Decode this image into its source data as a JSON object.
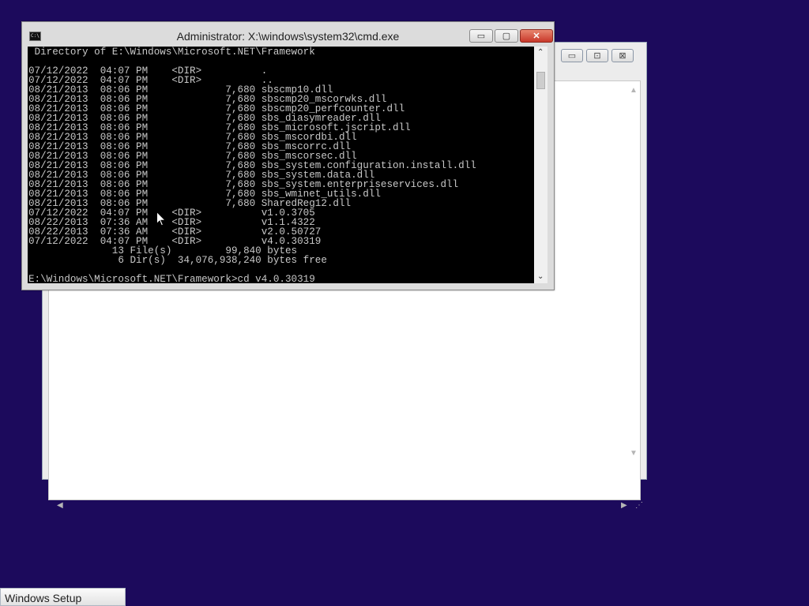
{
  "background_window": {
    "controls": {
      "minimize": "▭",
      "maximize": "⊡",
      "close": "⊠"
    }
  },
  "cmd_window": {
    "title": "Administrator: X:\\windows\\system32\\cmd.exe",
    "icon": "C:\\",
    "controls": {
      "minimize": "▭",
      "maximize": "▢",
      "close": "✕"
    },
    "console_lines": [
      " Directory of E:\\Windows\\Microsoft.NET\\Framework",
      "",
      "07/12/2022  04:07 PM    <DIR>          .",
      "07/12/2022  04:07 PM    <DIR>          ..",
      "08/21/2013  08:06 PM             7,680 sbscmp10.dll",
      "08/21/2013  08:06 PM             7,680 sbscmp20_mscorwks.dll",
      "08/21/2013  08:06 PM             7,680 sbscmp20_perfcounter.dll",
      "08/21/2013  08:06 PM             7,680 sbs_diasymreader.dll",
      "08/21/2013  08:06 PM             7,680 sbs_microsoft.jscript.dll",
      "08/21/2013  08:06 PM             7,680 sbs_mscordbi.dll",
      "08/21/2013  08:06 PM             7,680 sbs_mscorrc.dll",
      "08/21/2013  08:06 PM             7,680 sbs_mscorsec.dll",
      "08/21/2013  08:06 PM             7,680 sbs_system.configuration.install.dll",
      "08/21/2013  08:06 PM             7,680 sbs_system.data.dll",
      "08/21/2013  08:06 PM             7,680 sbs_system.enterpriseservices.dll",
      "08/21/2013  08:06 PM             7,680 sbs_wminet_utils.dll",
      "08/21/2013  08:06 PM             7,680 SharedReg12.dll",
      "07/12/2022  04:07 PM    <DIR>          v1.0.3705",
      "08/22/2013  07:36 AM    <DIR>          v1.1.4322",
      "08/22/2013  07:36 AM    <DIR>          v2.0.50727",
      "07/12/2022  04:07 PM    <DIR>          v4.0.30319",
      "              13 File(s)         99,840 bytes",
      "               6 Dir(s)  34,076,938,240 bytes free",
      "",
      "E:\\Windows\\Microsoft.NET\\Framework>cd v4.0.30319"
    ]
  },
  "taskbar": {
    "button_label": "Windows Setup"
  }
}
